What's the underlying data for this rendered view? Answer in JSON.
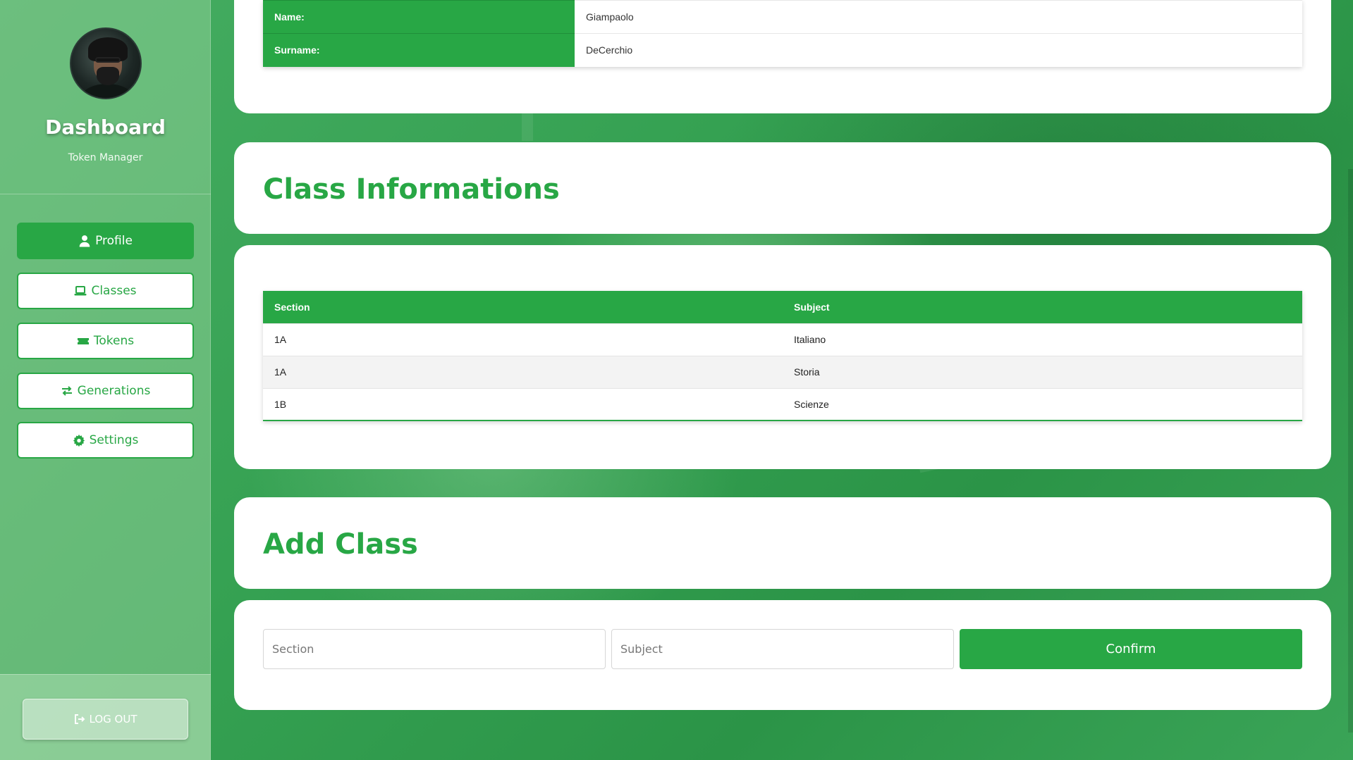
{
  "sidebar": {
    "title": "Dashboard",
    "subtitle": "Token Manager",
    "nav": [
      {
        "label": "Profile",
        "icon": "user-icon",
        "active": true
      },
      {
        "label": "Classes",
        "icon": "laptop-icon",
        "active": false
      },
      {
        "label": "Tokens",
        "icon": "ticket-icon",
        "active": false
      },
      {
        "label": "Generations",
        "icon": "exchange-icon",
        "active": false
      },
      {
        "label": "Settings",
        "icon": "gear-icon",
        "active": false
      }
    ],
    "logout_label": "LOG OUT"
  },
  "profile": {
    "rows": [
      {
        "key": "Name:",
        "value": "Giampaolo"
      },
      {
        "key": "Surname:",
        "value": "DeCerchio"
      }
    ]
  },
  "class_info": {
    "title": "Class Informations",
    "headers": [
      "Section",
      "Subject"
    ],
    "rows": [
      {
        "section": "1A",
        "subject": "Italiano"
      },
      {
        "section": "1A",
        "subject": "Storia"
      },
      {
        "section": "1B",
        "subject": "Scienze"
      }
    ]
  },
  "add_class": {
    "title": "Add Class",
    "section_placeholder": "Section",
    "subject_placeholder": "Subject",
    "confirm_label": "Confirm"
  },
  "colors": {
    "accent": "#28a745",
    "card": "#ffffff"
  }
}
